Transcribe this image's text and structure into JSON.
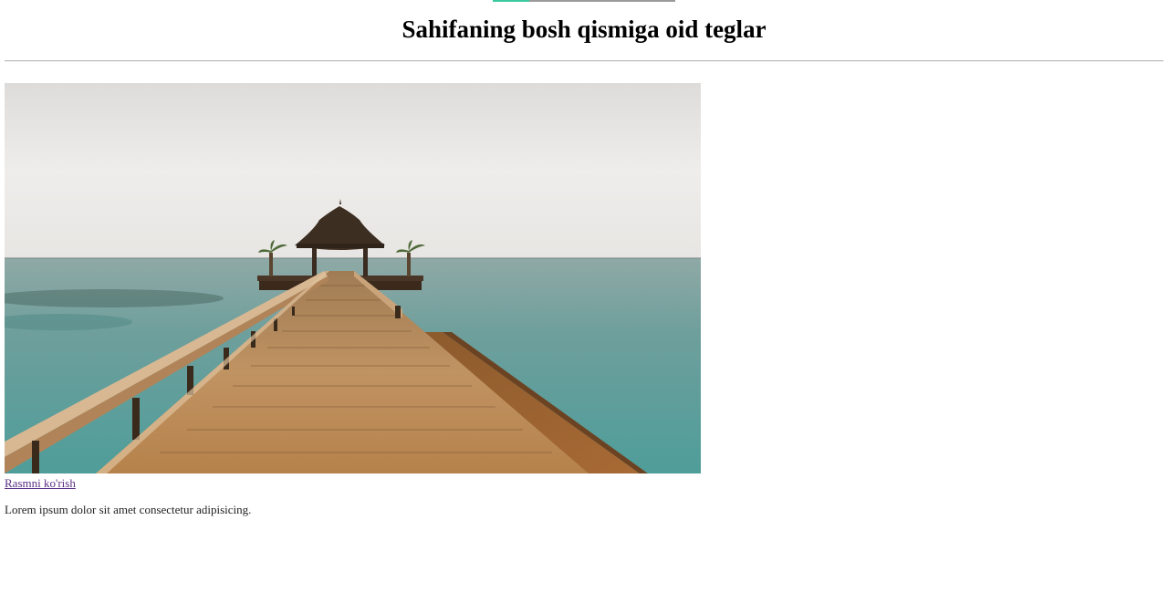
{
  "header": {
    "title": "Sahifaning bosh qismiga oid teglar"
  },
  "main": {
    "image": {
      "alt": "Wooden pier leading to a thatched gazebo over the sea"
    },
    "link_label": "Rasmni ko'rish",
    "paragraph": "Lorem ipsum dolor sit amet consectetur adipisicing."
  },
  "colors": {
    "link_visited": "#5a2d82",
    "accent": "#3cc9a0"
  }
}
